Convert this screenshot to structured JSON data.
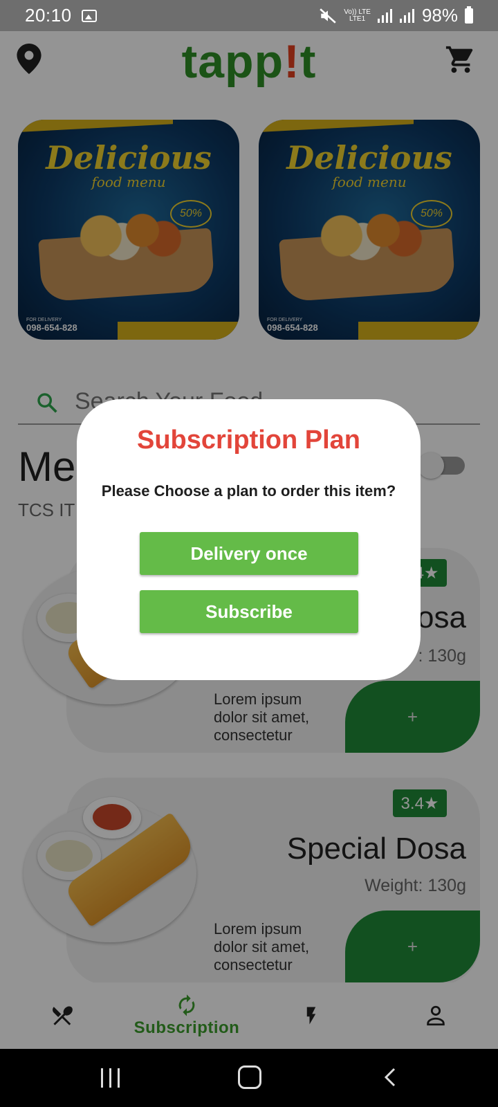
{
  "status_bar": {
    "time": "20:10",
    "network_top": "Vo)) LTE",
    "network_bottom": "LTE1",
    "battery": "98%"
  },
  "header": {
    "logo_left": "tapp",
    "logo_bang": "!",
    "logo_right": "t"
  },
  "promos": [
    {
      "title": "Delicious",
      "subtitle": "food menu",
      "badge": "50%",
      "phone_label": "FOR DELIVERY",
      "phone": "098-654-828"
    },
    {
      "title": "Delicious",
      "subtitle": "food menu",
      "badge": "50%",
      "phone_label": "FOR DELIVERY",
      "phone": "098-654-828"
    }
  ],
  "search": {
    "placeholder": "Search Your Food"
  },
  "menu": {
    "title": "Me",
    "subtitle": "TCS IT"
  },
  "items": [
    {
      "rating": "3.4★",
      "name": "osa",
      "weight": ": 130g",
      "description": "Lorem ipsum dolor sit amet, consectetur",
      "add_label": "+"
    },
    {
      "rating": "3.4★",
      "name": "Special Dosa",
      "weight": "Weight: 130g",
      "description": "Lorem ipsum dolor sit amet, consectetur",
      "add_label": "+"
    }
  ],
  "bottom_nav": {
    "active_label": "Subscription"
  },
  "dialog": {
    "title": "Subscription Plan",
    "message": "Please Choose a plan to order this item?",
    "btn_once": "Delivery once",
    "btn_subscribe": "Subscribe"
  },
  "colors": {
    "brand_green": "#2f8f26",
    "accent_green": "#1f8b37",
    "button_green": "#64bb48",
    "title_red": "#e2453a"
  }
}
